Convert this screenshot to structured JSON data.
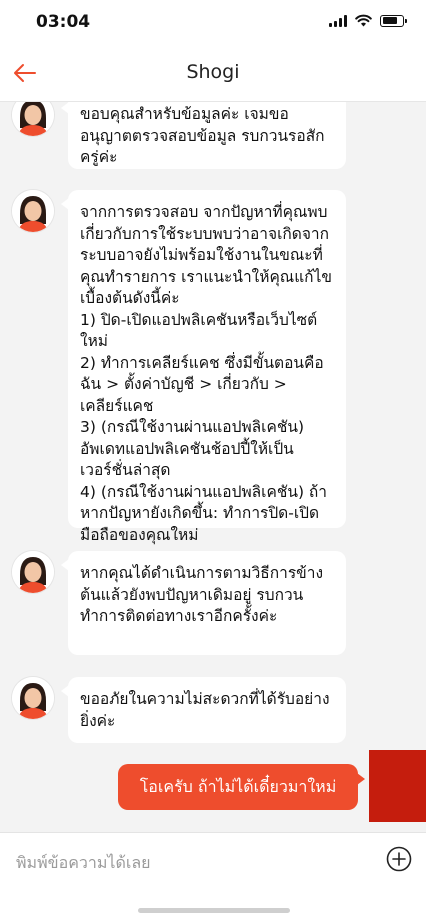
{
  "status_bar": {
    "time": "03:04",
    "battery_level": 0.8
  },
  "header": {
    "title": "Shogi",
    "back_icon": "arrow-left-icon",
    "accent_color": "#ee4d2d"
  },
  "messages": [
    {
      "from": "agent",
      "text": "ขอบคุณสำหรับข้อมูลค่ะ เจมขออนุญาตตรวจสอบข้อมูล รบกวนรอสักครู่ค่ะ"
    },
    {
      "from": "agent",
      "text": "จากการตรวจสอบ จากปัญหาที่คุณพบเกี่ยวกับการใช้ระบบพบว่าอาจเกิดจากระบบอาจยังไม่พร้อมใช้งานในขณะที่คุณทำรายการ เราแนะนำให้คุณแก้ไขเบื้องต้นดังนี้ค่ะ\n1) ปิด-เปิดแอปพลิเคชันหรือเว็บไซต์ใหม่\n2) ทำการเคลียร์แคช ซึ่งมีขั้นตอนคือ ฉัน > ตั้งค่าบัญชี > เกี่ยวกับ > เคลียร์แคช\n3) (กรณีใช้งานผ่านแอปพลิเคชัน) อัพเดทแอปพลิเคชันช้อปปี้ให้เป็นเวอร์ชั่นล่าสุด\n4) (กรณีใช้งานผ่านแอปพลิเคชัน) ถ้าหากปัญหายังเกิดขึ้น: ทำการปิด-เปิดมือถือของคุณใหม่"
    },
    {
      "from": "agent",
      "text": "หากคุณได้ดำเนินการตามวิธีการข้างต้นแล้วยังพบปัญหาเดิมอยู่ รบกวนทำการติดต่อทางเราอีกครั้งค่ะ"
    },
    {
      "from": "agent",
      "text": "ขออภัยในความไม่สะดวกที่ได้รับอย่างยิ่งค่ะ"
    },
    {
      "from": "user",
      "text": "โอเครับ ถ้าไม่ได้เดี๋ยวมาใหม่"
    }
  ],
  "input": {
    "placeholder": "พิมพ์ข้อความได้เลย",
    "value": "",
    "add_icon": "plus-circle-icon"
  }
}
